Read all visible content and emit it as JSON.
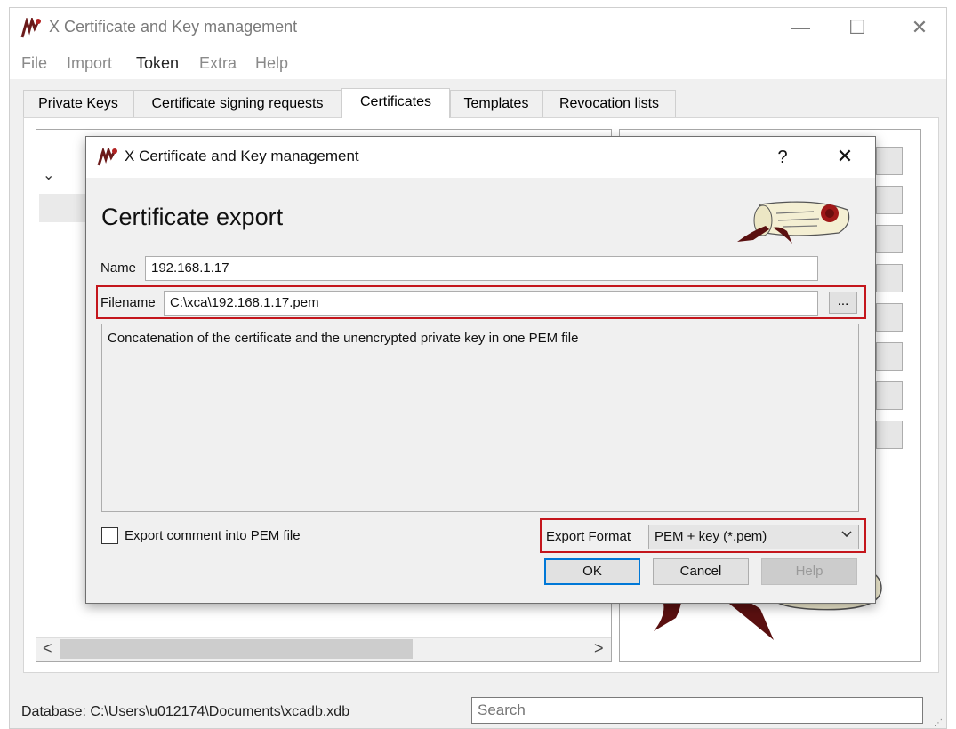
{
  "window": {
    "title": "X Certificate and Key management",
    "controls": {
      "minimize": "—",
      "maximize": "☐",
      "close": "✕"
    }
  },
  "menu": [
    {
      "label": "File",
      "mnemonic": "F"
    },
    {
      "label": "Import",
      "mnemonic": "I"
    },
    {
      "label": "Token"
    },
    {
      "label": "Extra"
    },
    {
      "label": "Help",
      "mnemonic": "H"
    }
  ],
  "tabs": [
    {
      "label": "Private Keys"
    },
    {
      "label": "Certificate signing requests"
    },
    {
      "label": "Certificates",
      "selected": true
    },
    {
      "label": "Templates"
    },
    {
      "label": "Revocation lists"
    }
  ],
  "list": {
    "expand_glyph": "⌄",
    "scroll_left": "<",
    "scroll_right": ">"
  },
  "status": {
    "database": "Database: C:\\Users\\u012174\\Documents\\xcadb.xdb"
  },
  "search": {
    "placeholder": "Search"
  },
  "dialog": {
    "title": "X Certificate and Key management",
    "help_glyph": "?",
    "close_glyph": "✕",
    "heading": "Certificate export",
    "name_label": "Name",
    "name_value": "192.168.1.17",
    "filename_label": "Filename",
    "filename_value": "C:\\xca\\192.168.1.17.pem",
    "browse_label": "...",
    "description": "Concatenation of the certificate and the unencrypted private key in one PEM file",
    "export_comment_label": "Export comment into PEM file",
    "export_comment_checked": false,
    "export_format_label": "Export Format",
    "export_format_value": "PEM + key (*.pem)",
    "buttons": {
      "ok": "OK",
      "cancel": "Cancel",
      "help": "Help"
    }
  },
  "colors": {
    "highlight": "#c4161c",
    "focus": "#0078d7",
    "logo_maroon": "#6b1a1a"
  }
}
